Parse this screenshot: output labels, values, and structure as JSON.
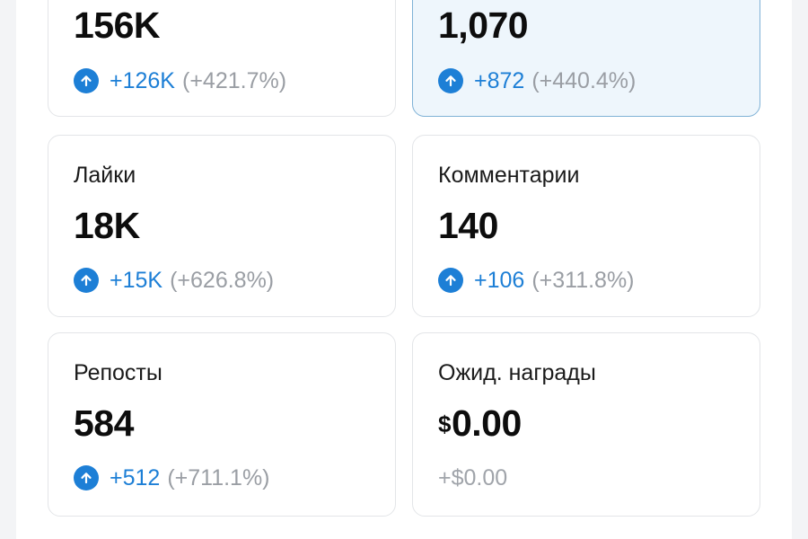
{
  "cards": [
    {
      "label": "",
      "value": "156K",
      "delta_abs": "+126K",
      "delta_pct": "(+421.7%)"
    },
    {
      "label": "",
      "value": "1,070",
      "delta_abs": "+872",
      "delta_pct": "(+440.4%)"
    },
    {
      "label": "Лайки",
      "value": "18K",
      "delta_abs": "+15K",
      "delta_pct": "(+626.8%)"
    },
    {
      "label": "Комментарии",
      "value": "140",
      "delta_abs": "+106",
      "delta_pct": "(+311.8%)"
    },
    {
      "label": "Репосты",
      "value": "584",
      "delta_abs": "+512",
      "delta_pct": "(+711.1%)"
    },
    {
      "label": "Ожид. награды",
      "currency": "$",
      "value": "0.00",
      "delta_text": "+$0.00"
    }
  ],
  "colors": {
    "accent": "#1d7fd6",
    "highlight_bg": "#eef6fc",
    "highlight_border": "#7fb2d6",
    "muted": "#9a9ea4"
  },
  "icons": {
    "delta_up": "arrow-up-circle-icon"
  }
}
